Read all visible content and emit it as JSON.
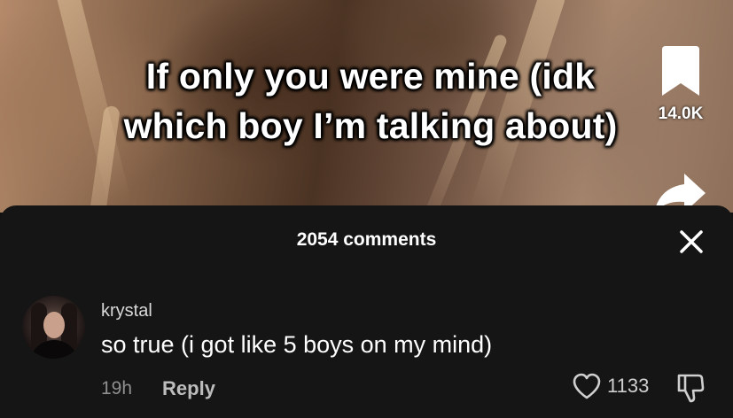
{
  "video": {
    "caption_line1": "If only you were mine (idk",
    "caption_line2": "which boy I’m talking about)",
    "bookmark_count": "14.0K",
    "icons": [
      "bookmark-icon",
      "share-icon"
    ]
  },
  "comments_sheet": {
    "title": "2054 comments",
    "close_icon": "close-icon",
    "comments": [
      {
        "username": "krystal",
        "text": "so true (i got like 5 boys on my mind)",
        "time": "19h",
        "reply_label": "Reply",
        "likes": "1133",
        "icons": [
          "heart-icon",
          "dislike-icon"
        ]
      }
    ]
  },
  "colors": {
    "sheet_background": "#151515",
    "text_primary": "#ffffff",
    "text_secondary": "#8f8f8f"
  }
}
